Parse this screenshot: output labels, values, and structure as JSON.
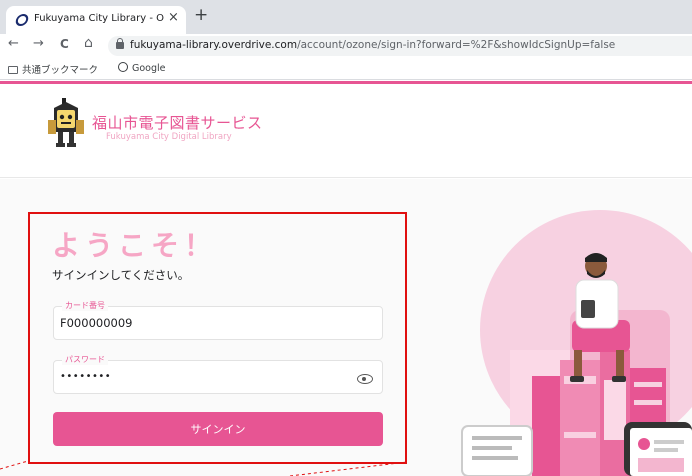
{
  "browser": {
    "tab_title": "Fukuyama City Library - OverDr",
    "tab_close": "×",
    "new_tab": "+",
    "nav": {
      "back": "←",
      "forward": "→",
      "reload": "C",
      "home": "⌂"
    },
    "url_host": "fukuyama-library.overdrive.com",
    "url_path": "/account/ozone/sign-in?forward=%2F&showIdcSignUp=false",
    "bookmarks": [
      {
        "label": "共通ブックマーク",
        "icon": "folder-icon"
      },
      {
        "label": "Google",
        "icon": "globe-icon"
      }
    ]
  },
  "site": {
    "logo_jp": "福山市電子図書サービス",
    "logo_en": "Fukuyama City Digital Library"
  },
  "login": {
    "welcome": "ようこそ！",
    "subtitle": "サインインしてください。",
    "card_label": "カード番号",
    "card_value": "F000000009",
    "password_label": "パスワード",
    "password_value": "••••••••",
    "signin_label": "サインイン"
  },
  "colors": {
    "brand_pink": "#e75593",
    "welcome_pink": "#f6a6c5",
    "highlight_red": "#e01010"
  }
}
